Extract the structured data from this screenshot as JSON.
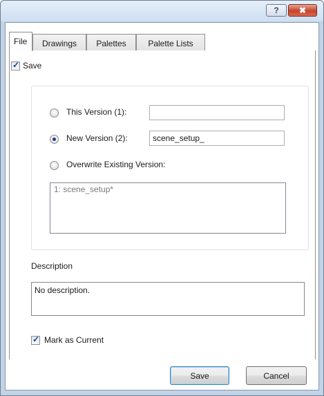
{
  "window": {
    "help_glyph": "?",
    "close_glyph": "✖"
  },
  "tabs": [
    {
      "label": "File",
      "active": true
    },
    {
      "label": "Drawings",
      "active": false
    },
    {
      "label": "Palettes",
      "active": false
    },
    {
      "label": "Palette Lists",
      "active": false
    }
  ],
  "save_checkbox": {
    "label": "Save",
    "checked": true
  },
  "version_options": {
    "this_version": {
      "label": "This Version (1):",
      "value": "",
      "selected": false
    },
    "new_version": {
      "label": "New Version (2):",
      "value": "scene_setup_",
      "selected": true
    },
    "overwrite": {
      "label": "Overwrite Existing Version:",
      "selected": false
    },
    "existing_versions": [
      "1: scene_setup*"
    ]
  },
  "description": {
    "label": "Description",
    "value": "No description."
  },
  "mark_as_current": {
    "label": "Mark as Current",
    "checked": true
  },
  "buttons": {
    "save": "Save",
    "cancel": "Cancel"
  },
  "colors": {
    "title_bar": "#cedff1",
    "close_button": "#c7432a",
    "radio_dot": "#1f3c8a"
  }
}
